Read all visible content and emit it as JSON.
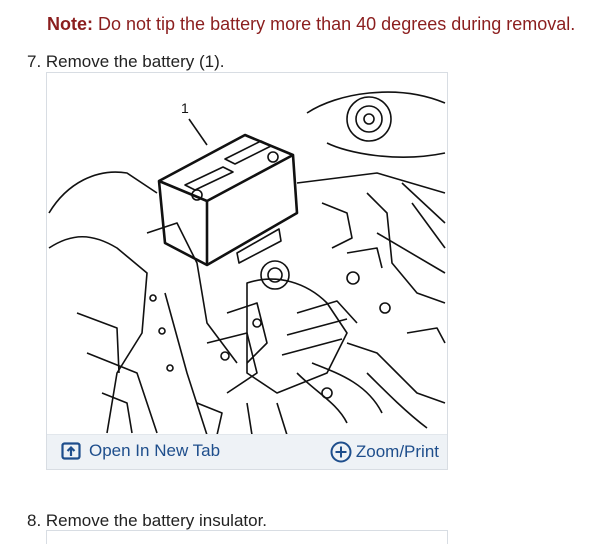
{
  "note": {
    "label": "Note:",
    "text": " Do not tip the battery more than 40 degrees during removal."
  },
  "steps": [
    {
      "text": "7. Remove the battery (1)."
    },
    {
      "text": "8. Remove the battery insulator."
    }
  ],
  "figure": {
    "callout": "1",
    "open_label": "Open In New Tab",
    "zoom_label": "Zoom/Print",
    "open_icon": "open-in-new-tab-icon",
    "zoom_icon": "zoom-plus-icon",
    "accent": "#1e4e8c"
  }
}
